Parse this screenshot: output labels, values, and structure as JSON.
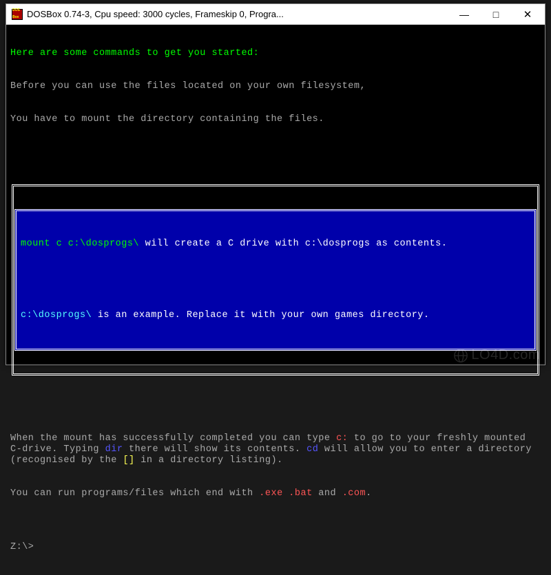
{
  "titlebar": {
    "title": "DOSBox 0.74-3, Cpu speed:    3000 cycles, Frameskip  0, Progra...",
    "minimize": "—",
    "maximize": "□",
    "close": "✕"
  },
  "terminal": {
    "header": "Here are some commands to get you started:",
    "intro1": "Before you can use the files located on your own filesystem,",
    "intro2": "You have to mount the directory containing the files.",
    "box": {
      "line1_cmd": "mount c c:\\dosprogs\\",
      "line1_rest": " will create a C drive with c:\\dosprogs as contents.",
      "line2_cmd": "c:\\dosprogs\\",
      "line2_rest": " is an example. Replace it with your own games directory."
    },
    "para": {
      "seg1": "When the mount has successfully completed you can type ",
      "c_colon": "c:",
      "seg2": " to go to your freshly mounted C-drive. Typing ",
      "dir": "dir",
      "seg3": " there will show its contents. ",
      "cd": "cd",
      "seg4": " will allow you to enter a directory (recognised by the ",
      "brackets": "[]",
      "seg5": " in a directory listing).",
      "seg6": "You can run programs/files which end with ",
      "exe": ".exe",
      "sp1": " ",
      "bat": ".bat",
      "and": " and ",
      "com": ".com",
      "period": "."
    },
    "prompt": "Z:\\>"
  },
  "watermark": "LO4D.com"
}
